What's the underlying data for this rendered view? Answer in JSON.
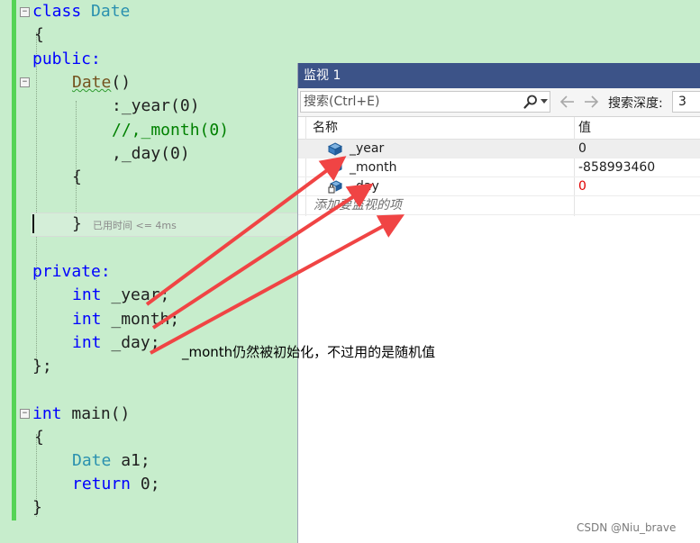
{
  "editor": {
    "lines": {
      "l1_kw": "class",
      "l1_type": "Date",
      "l2": "{",
      "l3": "public:",
      "l4_ctor": "Date",
      "l4_parens": "()",
      "l5": ":_year(0)",
      "l6": "//,_month(0)",
      "l7": ",_day(0)",
      "l8": "{",
      "l9": "}",
      "l11": "private:",
      "l12_kw": "int",
      "l12_rest": " _year;",
      "l13_kw": "int",
      "l13_rest": " _month;",
      "l14_kw": "int",
      "l14_rest": " _day;",
      "l15": "};",
      "l17_kw": "int",
      "l17_rest": " main()",
      "l18": "{",
      "l19_type": "Date",
      "l19_rest": " a1;",
      "l20_kw": "return",
      "l20_rest": " 0;",
      "l21": "}"
    },
    "elapsed_hint": "已用时间 <= 4ms",
    "fold_glyph": "−"
  },
  "watch": {
    "title": "监视 1",
    "search_placeholder": "搜索(Ctrl+E)",
    "depth_label": "搜索深度:",
    "depth_value": "3",
    "col_name": "名称",
    "col_value": "值",
    "rows": [
      {
        "name": "_year",
        "value": "0"
      },
      {
        "name": "_month",
        "value": "-858993460"
      },
      {
        "name": "_day",
        "value": "0"
      }
    ],
    "add_item": "添加要监视的项"
  },
  "annotation": "_month仍然被初始化，不过用的是随机值",
  "watermark": "CSDN @Niu_brave",
  "colors": {
    "editor_bg": "#c7edcc",
    "title_bar": "#3c5388",
    "arrow": "#f04444",
    "changed_value": "#e00000"
  }
}
